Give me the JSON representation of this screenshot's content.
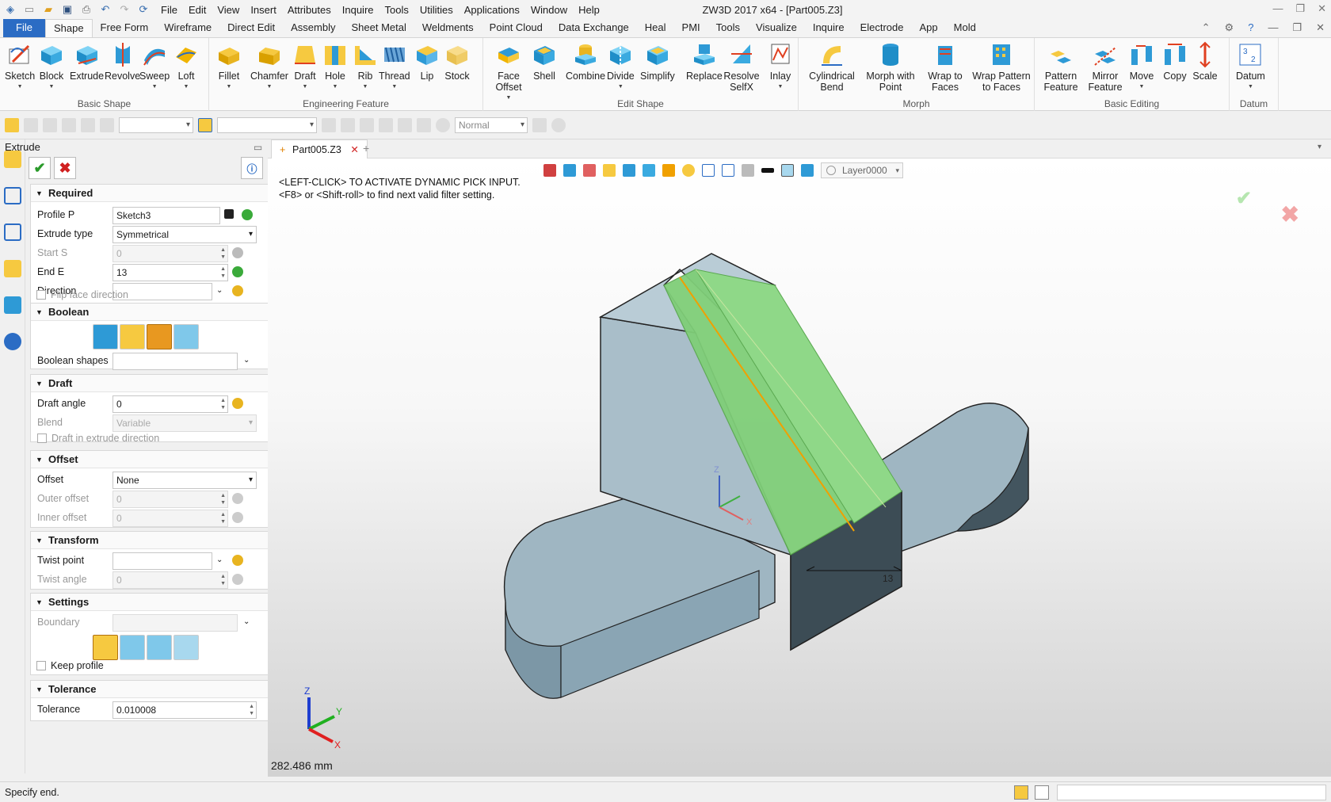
{
  "window": {
    "title": "ZW3D 2017  x64 - [Part005.Z3]",
    "menu": [
      "File",
      "Edit",
      "View",
      "Insert",
      "Attributes",
      "Inquire",
      "Tools",
      "Utilities",
      "Applications",
      "Window",
      "Help"
    ]
  },
  "ribbon_tabs": [
    "File",
    "Shape",
    "Free Form",
    "Wireframe",
    "Direct Edit",
    "Assembly",
    "Sheet Metal",
    "Weldments",
    "Point Cloud",
    "Data Exchange",
    "Heal",
    "PMI",
    "Tools",
    "Visualize",
    "Inquire",
    "Electrode",
    "App",
    "Mold"
  ],
  "active_tab": "Shape",
  "ribbon": {
    "groups": [
      {
        "title": "Basic Shape",
        "buttons": [
          "Sketch",
          "Block",
          "Extrude",
          "Revolve",
          "Sweep",
          "Loft"
        ]
      },
      {
        "title": "Engineering Feature",
        "buttons": [
          "Fillet",
          "Chamfer",
          "Draft",
          "Hole",
          "Rib",
          "Thread",
          "Lip",
          "Stock"
        ]
      },
      {
        "title": "Edit Shape",
        "buttons": [
          "Face Offset",
          "Shell",
          "Combine",
          "Divide",
          "Simplify",
          "Replace",
          "Resolve SelfX",
          "Inlay"
        ]
      },
      {
        "title": "Morph",
        "buttons": [
          "Cylindrical Bend",
          "Morph with Point",
          "Wrap to Faces",
          "Wrap Pattern to Faces"
        ]
      },
      {
        "title": "Basic Editing",
        "buttons": [
          "Pattern Feature",
          "Mirror Feature",
          "Move",
          "Copy",
          "Scale"
        ]
      },
      {
        "title": "Datum",
        "buttons": [
          "Datum"
        ]
      }
    ]
  },
  "toolbar": {
    "render_mode": "Normal"
  },
  "panel": {
    "title": "Extrude",
    "required": {
      "title": "Required",
      "profile_label": "Profile P",
      "profile_value": "Sketch3",
      "extrude_type_label": "Extrude type",
      "extrude_type_value": "Symmetrical",
      "start_label": "Start S",
      "start_value": "0",
      "end_label": "End E",
      "end_value": "13",
      "direction_label": "Direction",
      "direction_value": "",
      "flip_label": "Flip face direction"
    },
    "boolean": {
      "title": "Boolean",
      "shapes_label": "Boolean shapes",
      "shapes_value": ""
    },
    "draft": {
      "title": "Draft",
      "angle_label": "Draft angle",
      "angle_value": "0",
      "blend_label": "Blend",
      "blend_value": "Variable",
      "in_dir_label": "Draft in extrude direction"
    },
    "offset": {
      "title": "Offset",
      "offset_label": "Offset",
      "offset_value": "None",
      "outer_label": "Outer offset",
      "outer_value": "0",
      "inner_label": "Inner offset",
      "inner_value": "0"
    },
    "transform": {
      "title": "Transform",
      "twist_point_label": "Twist point",
      "twist_point_value": "",
      "twist_angle_label": "Twist angle",
      "twist_angle_value": "0"
    },
    "settings": {
      "title": "Settings",
      "boundary_label": "Boundary",
      "boundary_value": "",
      "keep_label": "Keep profile"
    },
    "tolerance": {
      "title": "Tolerance",
      "label": "Tolerance",
      "value": "0.010008"
    }
  },
  "document": {
    "tab": "Part005.Z3",
    "message_line1": "<LEFT-CLICK> TO ACTIVATE DYNAMIC PICK INPUT.",
    "message_line2": "<F8> or <Shift-roll> to find next valid filter setting.",
    "layer": "Layer0000",
    "dimension": "13",
    "measure": "282.486 mm",
    "axes": {
      "x": "X",
      "y": "Y",
      "z": "Z"
    }
  },
  "status": {
    "text": "Specify end."
  },
  "colors": {
    "accent": "#2b6cc4",
    "preview_green": "#7fce78",
    "body": "#9fb6c2",
    "orange": "#f0a000"
  }
}
